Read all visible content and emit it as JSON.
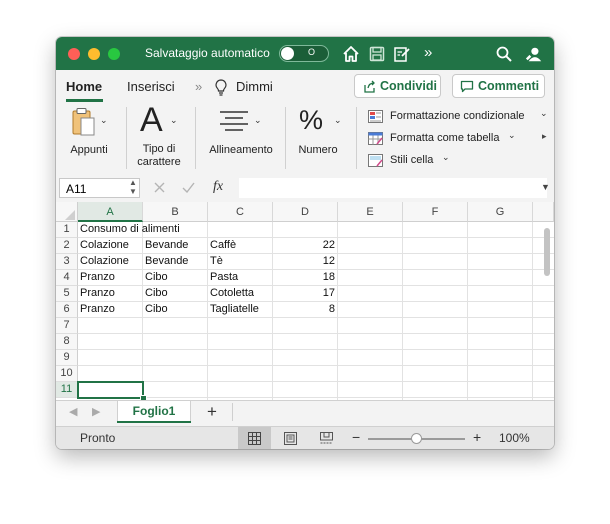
{
  "titlebar": {
    "autosave_label": "Salvataggio automatico",
    "autosave_state": "O",
    "accent_color": "#217346"
  },
  "ribbon_tabs": {
    "home": "Home",
    "insert": "Inserisci",
    "more": "»",
    "tell_me": "Dimmi",
    "share_label": "Condividi",
    "comments_label": "Commenti"
  },
  "ribbon": {
    "paste_label": "Appunti",
    "font_label_line1": "Tipo di",
    "font_label_line2": "carattere",
    "font_icon": "A",
    "align_label": "Allineamento",
    "number_label": "Numero",
    "number_icon": "%",
    "conditional_formatting": "Formattazione condizionale",
    "format_as_table": "Formatta come tabella",
    "cell_styles": "Stili cella"
  },
  "formula_bar": {
    "name_box": "A11",
    "fx": "fx"
  },
  "sheet": {
    "columns": [
      "A",
      "B",
      "C",
      "D",
      "E",
      "F",
      "G"
    ],
    "rows": [
      "1",
      "2",
      "3",
      "4",
      "5",
      "6",
      "7",
      "8",
      "9",
      "10",
      "11"
    ],
    "title": "Consumo di alimenti",
    "data": [
      [
        "Colazione",
        "Bevande",
        "Caffè",
        "22"
      ],
      [
        "Colazione",
        "Bevande",
        "Tè",
        "12"
      ],
      [
        "Pranzo",
        "Cibo",
        "Pasta",
        "18"
      ],
      [
        "Pranzo",
        "Cibo",
        "Cotoletta",
        "17"
      ],
      [
        "Pranzo",
        "Cibo",
        "Tagliatelle",
        "8"
      ]
    ],
    "selected_cell": "A11"
  },
  "sheet_tabs": {
    "active_sheet": "Foglio1",
    "add_sheet": "+"
  },
  "status": {
    "ready": "Pronto",
    "zoom_minus": "−",
    "zoom_plus": "+",
    "zoom": "100%",
    "zoom_fraction": 0.5
  }
}
